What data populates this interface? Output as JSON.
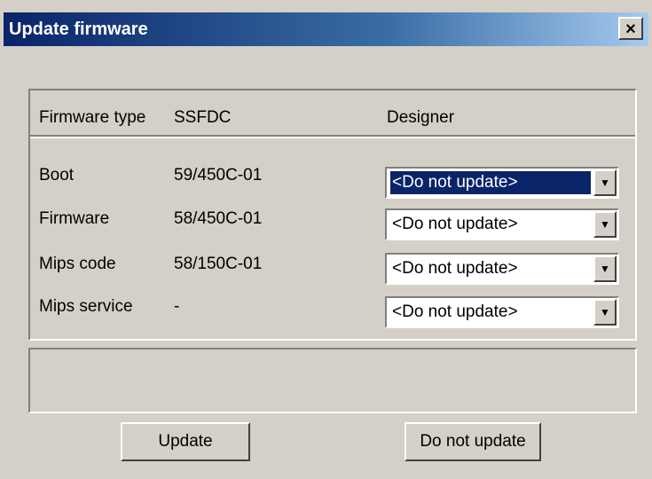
{
  "window": {
    "title": "Update firmware",
    "close_symbol": "×",
    "close_icon": "close-icon"
  },
  "header": {
    "firmware_type_label": "Firmware type",
    "type_value": "SSFDC",
    "designer_label": "Designer"
  },
  "rows": [
    {
      "label": "Boot",
      "version": "59/450C-01",
      "selected": "<Do not update>"
    },
    {
      "label": "Firmware",
      "version": "58/450C-01",
      "selected": "<Do not update>"
    },
    {
      "label": "Mips code",
      "version": "58/150C-01",
      "selected": "<Do not update>"
    },
    {
      "label": "Mips service",
      "version": "-",
      "selected": "<Do not update>"
    }
  ],
  "dropdown_arrow_symbol": "▼",
  "dropdown_arrow_icon": "chevron-down-icon",
  "message": "",
  "buttons": {
    "update": "Update",
    "do_not_update": "Do not update"
  },
  "colors": {
    "titlebar_start": "#0a246a",
    "titlebar_end": "#a6caf0",
    "dialog_bg": "#d4d0c8",
    "selection_bg": "#0a246a"
  }
}
